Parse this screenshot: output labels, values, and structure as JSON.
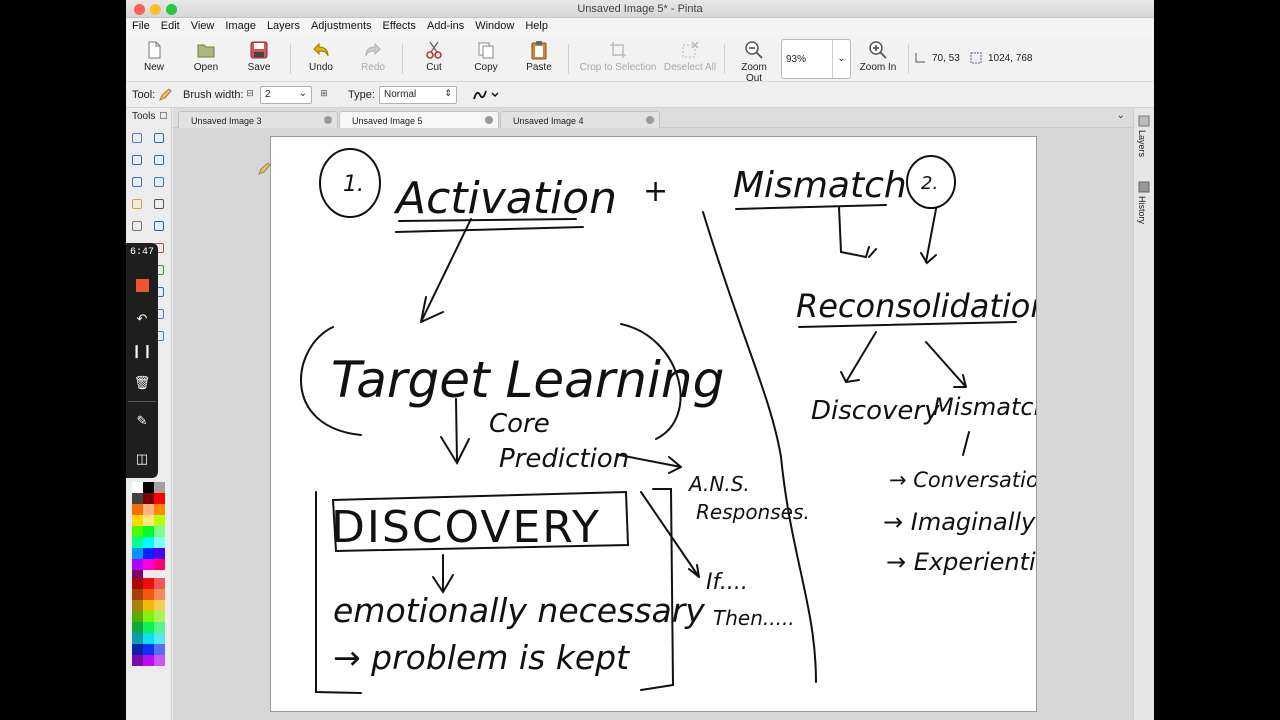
{
  "window": {
    "title": "Unsaved Image 5* - Pinta"
  },
  "menu": [
    "File",
    "Edit",
    "View",
    "Image",
    "Layers",
    "Adjustments",
    "Effects",
    "Add-ins",
    "Window",
    "Help"
  ],
  "toolbar": {
    "new": "New",
    "open": "Open",
    "save": "Save",
    "undo": "Undo",
    "redo": "Redo",
    "cut": "Cut",
    "copy": "Copy",
    "paste": "Paste",
    "crop": "Crop to Selection",
    "deselect": "Deselect All",
    "zoom_out": "Zoom Out",
    "zoom_value": "93%",
    "zoom_in": "Zoom In",
    "cursor_pos": "70, 53",
    "image_size": "1024, 768"
  },
  "options": {
    "tool_label": "Tool:",
    "brush_label": "Brush width:",
    "brush_width": "2",
    "type_label": "Type:",
    "type_value": "Normal"
  },
  "tools_panel": {
    "title": "Tools"
  },
  "tabs": [
    {
      "label": "Unsaved Image 3"
    },
    {
      "label": "Unsaved Image 5"
    },
    {
      "label": "Unsaved Image 4"
    }
  ],
  "right_panel": {
    "layers": "Layers",
    "history": "History"
  },
  "recorder": {
    "time": "6:47"
  },
  "drawing": {
    "activation_num": "1.",
    "activation": "Activation",
    "plus": "+",
    "mismatch": "Mismatch",
    "mismatch_num": "2.",
    "reconsolidation": "Reconsolidation.",
    "discovery_right": "Discovery",
    "mismatch_right": "Mismatch",
    "conversationally": "→ Conversationally",
    "imaginally": "→ Imaginally",
    "experiential": "→ Experiential.",
    "target_learning": "Target Learning",
    "core": "Core",
    "prediction": "Prediction",
    "ans": "A.N.S.",
    "responses": "Responses.",
    "if": "If....",
    "then": "Then.....",
    "discovery": "DISCOVERY",
    "emotionally": "emotionally necessary",
    "problem_kept": "→ problem is kept"
  },
  "colors": {
    "palette": [
      "#ffffff",
      "#000000",
      "#a0a0a0",
      "#404040",
      "#7f0000",
      "#ff0000",
      "#ff6a00",
      "#ffb27f",
      "#ff8c00",
      "#ffd800",
      "#ffe97f",
      "#b6ff00",
      "#4cff00",
      "#00ff21",
      "#7fff8e",
      "#00ff90",
      "#00ffff",
      "#7fffff",
      "#0094ff",
      "#0026ff",
      "#4800ff",
      "#b200ff",
      "#ff00dc",
      "#ff006e",
      "#7f006e"
    ]
  }
}
